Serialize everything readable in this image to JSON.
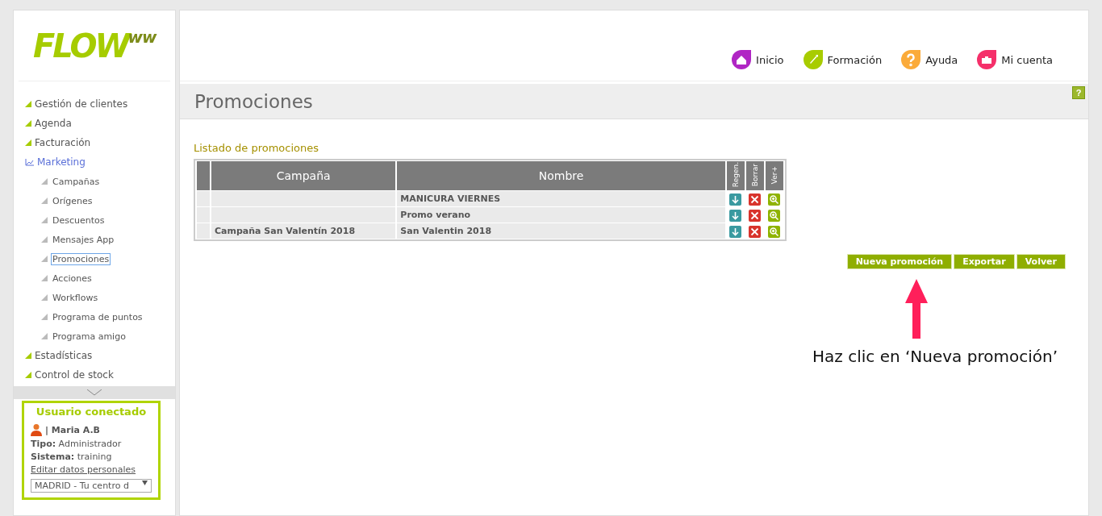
{
  "logo": {
    "text": "FLOW",
    "mark": "ww"
  },
  "top_menu": [
    {
      "label": "Inicio",
      "color": "#b026c4"
    },
    {
      "label": "Formación",
      "color": "#a8cc00"
    },
    {
      "label": "Ayuda",
      "color": "#fbab3a"
    },
    {
      "label": "Mi cuenta",
      "color": "#f5306a"
    }
  ],
  "sidebar": {
    "items": [
      {
        "label": "Gestión de clientes",
        "selected": false
      },
      {
        "label": "Agenda",
        "selected": false
      },
      {
        "label": "Facturación",
        "selected": false
      },
      {
        "label": "Marketing",
        "selected": true,
        "children": [
          {
            "label": "Campañas",
            "selected": false
          },
          {
            "label": "Orígenes",
            "selected": false
          },
          {
            "label": "Descuentos",
            "selected": false
          },
          {
            "label": "Mensajes App",
            "selected": false
          },
          {
            "label": "Promociones",
            "selected": true
          },
          {
            "label": "Acciones",
            "selected": false
          },
          {
            "label": "Workflows",
            "selected": false
          },
          {
            "label": "Programa de puntos",
            "selected": false
          },
          {
            "label": "Programa amigo",
            "selected": false
          }
        ]
      },
      {
        "label": "Estadísticas",
        "selected": false
      },
      {
        "label": "Control de stock",
        "selected": false
      }
    ]
  },
  "user_panel": {
    "title": "Usuario conectado",
    "name": "| Maria A.B",
    "type_label": "Tipo:",
    "type_value": "Administrador",
    "system_label": "Sistema:",
    "system_value": "training",
    "edit_link": "Editar datos personales",
    "center_select": "MADRID - Tu centro d"
  },
  "page": {
    "title": "Promociones",
    "help": "?",
    "section_title": "Listado de promociones"
  },
  "table": {
    "columns": [
      "Campaña",
      "Nombre"
    ],
    "action_columns": [
      "Regen.",
      "Borrar",
      "Ver+"
    ],
    "rows": [
      {
        "campaign": "",
        "name": "MANICURA VIERNES"
      },
      {
        "campaign": "",
        "name": "Promo verano"
      },
      {
        "campaign": "Campaña San Valentín 2018",
        "name": "San Valentin 2018"
      }
    ]
  },
  "buttons": [
    "Nueva promoción",
    "Exportar",
    "Volver"
  ],
  "annotation": {
    "text": "Haz clic en ‘Nueva promoción’"
  }
}
